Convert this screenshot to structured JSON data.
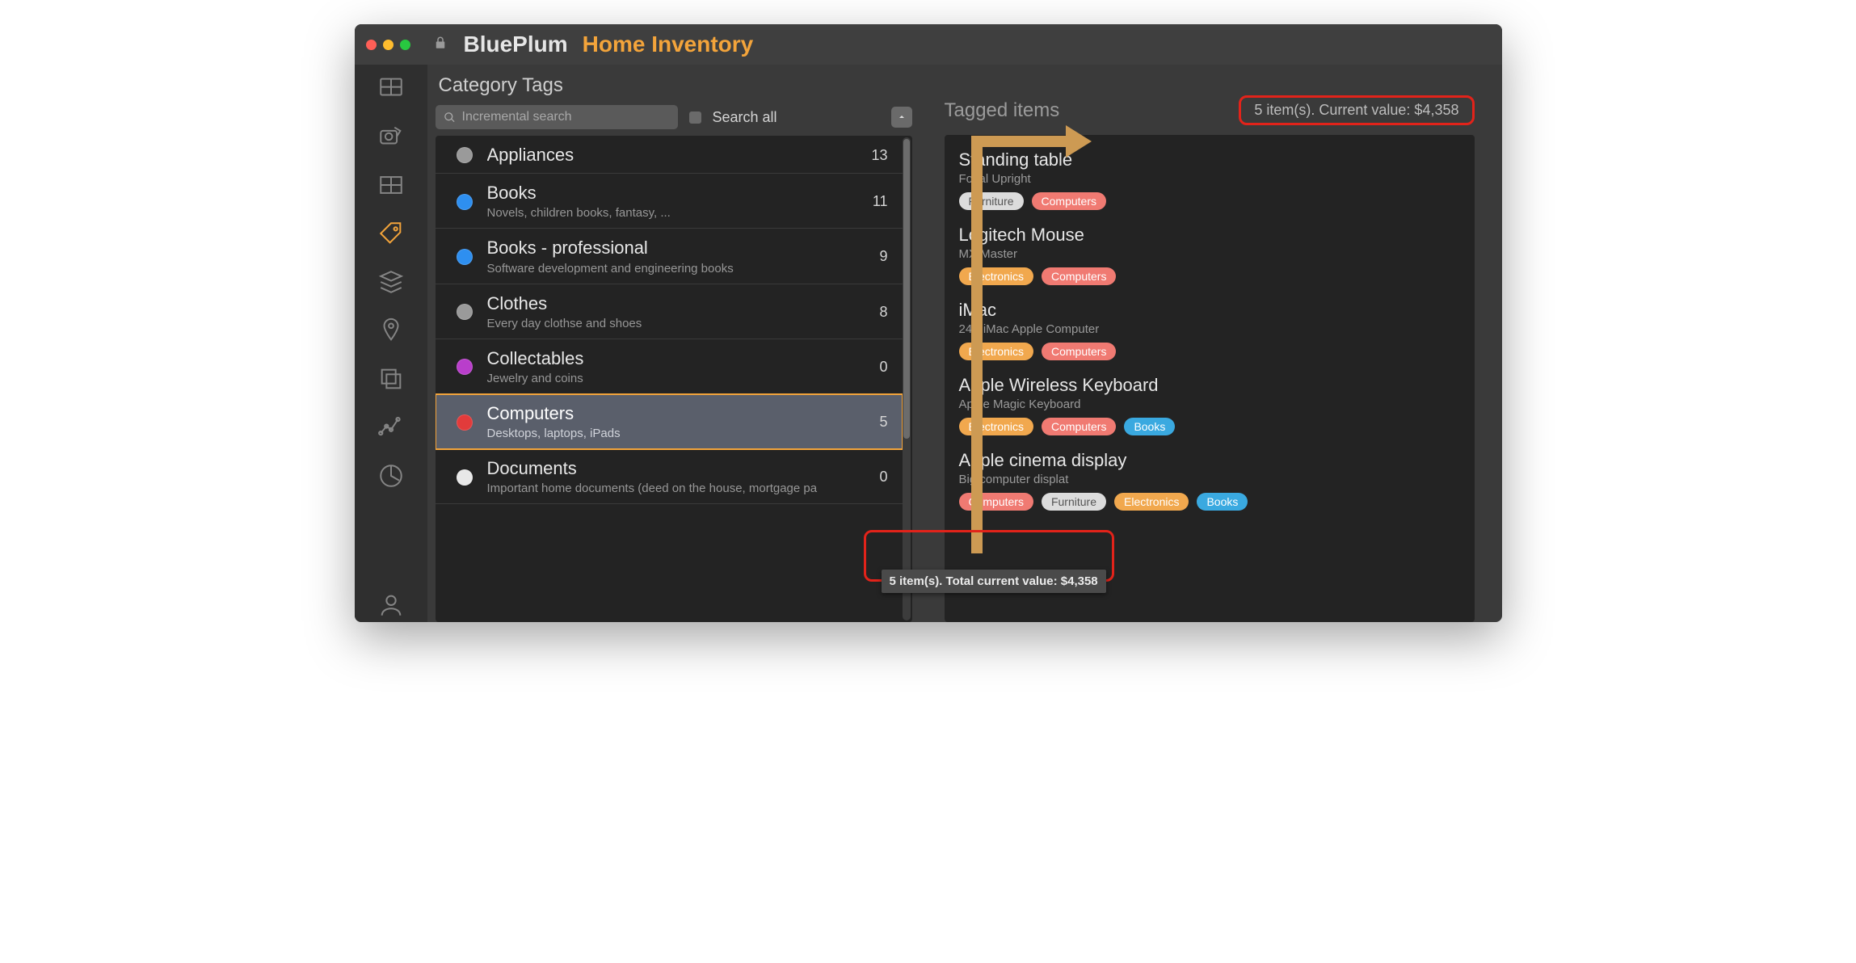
{
  "app": {
    "brand": "BluePlum",
    "subtitle": "Home Inventory"
  },
  "rail": [
    {
      "name": "dashboard-icon"
    },
    {
      "name": "camera-save-icon"
    },
    {
      "name": "rooms-icon"
    },
    {
      "name": "tag-icon",
      "active": true
    },
    {
      "name": "stack-icon"
    },
    {
      "name": "pin-icon"
    },
    {
      "name": "duplicate-icon"
    },
    {
      "name": "analytics-icon"
    },
    {
      "name": "pie-icon"
    },
    {
      "name": "user-icon"
    }
  ],
  "left": {
    "title": "Category Tags",
    "search_placeholder": "Incremental search",
    "search_all_label": "Search all"
  },
  "categories": [
    {
      "name": "Appliances",
      "desc": "",
      "count": 13,
      "color": "#9a9a9a"
    },
    {
      "name": "Books",
      "desc": "Novels, children books, fantasy, ...",
      "count": 11,
      "color": "#2e8ff0"
    },
    {
      "name": "Books - professional",
      "desc": "Software development and engineering books",
      "count": 9,
      "color": "#2e8ff0"
    },
    {
      "name": "Clothes",
      "desc": "Every day clothse and shoes",
      "count": 8,
      "color": "#9a9a9a"
    },
    {
      "name": "Collectables",
      "desc": "Jewelry and coins",
      "count": 0,
      "color": "#b93ecb"
    },
    {
      "name": "Computers",
      "desc": "Desktops, laptops, iPads",
      "count": 5,
      "color": "#e23b3b",
      "selected": true
    },
    {
      "name": "Documents",
      "desc": "Important home documents (deed on the house, mortgage pa",
      "count": 0,
      "color": "#e8e8e8"
    }
  ],
  "tooltip": "5 item(s). Total current value: $4,358",
  "right": {
    "title": "Tagged items",
    "stats": "5 item(s). Current value: $4,358"
  },
  "items": [
    {
      "name": "Standing table",
      "sub": "Focal Upright",
      "tags": [
        {
          "label": "Furniture",
          "cls": "grey"
        },
        {
          "label": "Computers",
          "cls": "coral"
        }
      ]
    },
    {
      "name": "Logitech Mouse",
      "sub": "MX Master",
      "tags": [
        {
          "label": "Electronics",
          "cls": "orange"
        },
        {
          "label": "Computers",
          "cls": "coral"
        }
      ]
    },
    {
      "name": "iMac",
      "sub": "24 \" iMac Apple Computer",
      "tags": [
        {
          "label": "Electronics",
          "cls": "orange"
        },
        {
          "label": "Computers",
          "cls": "coral"
        }
      ]
    },
    {
      "name": "Apple Wireless Keyboard",
      "sub": "Apple Magic Keyboard",
      "tags": [
        {
          "label": "Electronics",
          "cls": "orange"
        },
        {
          "label": "Computers",
          "cls": "coral"
        },
        {
          "label": "Books",
          "cls": "blue"
        }
      ]
    },
    {
      "name": "Apple cinema display",
      "sub": "Big computer displat",
      "tags": [
        {
          "label": "Computers",
          "cls": "coral"
        },
        {
          "label": "Furniture",
          "cls": "grey"
        },
        {
          "label": "Electronics",
          "cls": "orange"
        },
        {
          "label": "Books",
          "cls": "blue"
        }
      ]
    }
  ]
}
